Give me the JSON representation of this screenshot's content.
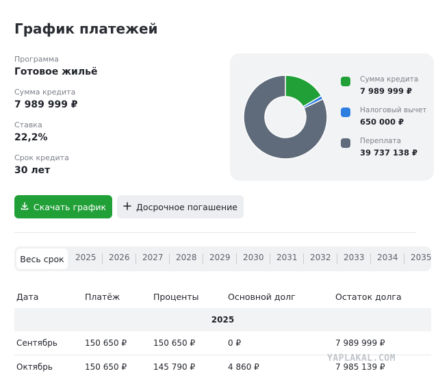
{
  "page": {
    "title": "График платежей"
  },
  "info": [
    {
      "label": "Программа",
      "value": "Готовое жильё"
    },
    {
      "label": "Сумма кредита",
      "value": "7 989 999 ₽"
    },
    {
      "label": "Ставка",
      "value": "22,2%"
    },
    {
      "label": "Срок кредита",
      "value": "30 лет"
    }
  ],
  "chart_data": {
    "type": "pie",
    "categories": [
      "Сумма кредита",
      "Налоговый вычет",
      "Переплата"
    ],
    "values": [
      7989999,
      650000,
      39737138
    ],
    "labels": [
      "7 989 999 ₽",
      "650 000 ₽",
      "39 737 138 ₽"
    ],
    "colors": [
      "#21a038",
      "#2e7de1",
      "#5f6b7a"
    ],
    "legend": "right"
  },
  "buttons": {
    "download": "Скачать график",
    "early": "Досрочное погашение"
  },
  "tabs": {
    "all": "Весь срок",
    "years": [
      "2025",
      "2026",
      "2027",
      "2028",
      "2029",
      "2030",
      "2031",
      "2032",
      "2033",
      "2034",
      "2035"
    ]
  },
  "table": {
    "headers": [
      "Дата",
      "Платёж",
      "Проценты",
      "Основной долг",
      "Остаток долга"
    ],
    "group": "2025",
    "rows": [
      [
        "Сентябрь",
        "150 650 ₽",
        "150 650 ₽",
        "0 ₽",
        "7 989 999 ₽"
      ],
      [
        "Октябрь",
        "150 650 ₽",
        "145 790 ₽",
        "4 860 ₽",
        "7 985 139 ₽"
      ]
    ]
  },
  "watermark": "YAPLAKAL.COM"
}
